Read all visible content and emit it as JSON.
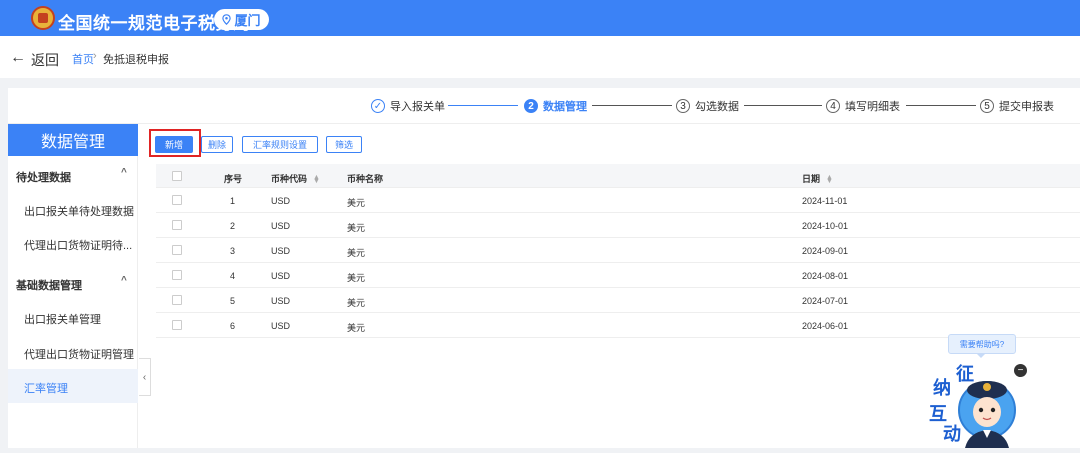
{
  "header": {
    "title": "全国统一规范电子税务局",
    "city": "厦门"
  },
  "breadcrumb": {
    "back_label": "返回",
    "back_arrow": "←",
    "home": "首页",
    "separator": "›",
    "current": "免抵退税申报"
  },
  "steps": [
    {
      "num": "✓",
      "label": "导入报关单",
      "state": "done"
    },
    {
      "num": "2",
      "label": "数据管理",
      "state": "active"
    },
    {
      "num": "3",
      "label": "勾选数据",
      "state": "todo"
    },
    {
      "num": "4",
      "label": "填写明细表",
      "state": "todo"
    },
    {
      "num": "5",
      "label": "提交申报表",
      "state": "todo"
    }
  ],
  "sidebar": {
    "title": "数据管理",
    "groups": [
      {
        "label": "待处理数据",
        "chevron": "^",
        "items": [
          "出口报关单待处理数据",
          "代理出口货物证明待..."
        ]
      },
      {
        "label": "基础数据管理",
        "chevron": "^",
        "items": [
          "出口报关单管理",
          "代理出口货物证明管理",
          "汇率管理"
        ]
      }
    ],
    "collapse_glyph": "‹"
  },
  "toolbar": {
    "add_label": "新增",
    "delete_label": "删除",
    "rate_rule_label": "汇率规则设置",
    "filter_label": "筛选"
  },
  "table": {
    "headers": {
      "index": "序号",
      "code": "币种代码",
      "name": "币种名称",
      "date": "日期"
    },
    "rows": [
      {
        "index": "1",
        "code": "USD",
        "name": "美元",
        "date": "2024-11-01"
      },
      {
        "index": "2",
        "code": "USD",
        "name": "美元",
        "date": "2024-10-01"
      },
      {
        "index": "3",
        "code": "USD",
        "name": "美元",
        "date": "2024-09-01"
      },
      {
        "index": "4",
        "code": "USD",
        "name": "美元",
        "date": "2024-08-01"
      },
      {
        "index": "5",
        "code": "USD",
        "name": "美元",
        "date": "2024-07-01"
      },
      {
        "index": "6",
        "code": "USD",
        "name": "美元",
        "date": "2024-06-01"
      }
    ]
  },
  "assistant": {
    "bubble": "需要帮助吗?",
    "close_glyph": "−",
    "chars": [
      "征",
      "纳",
      "互",
      "动"
    ]
  },
  "colors": {
    "brand": "#3b82f6",
    "highlight": "#e02424"
  }
}
